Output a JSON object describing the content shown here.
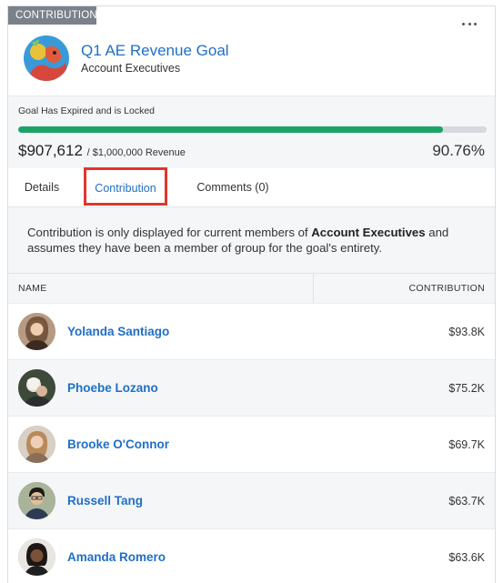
{
  "card": {
    "type_tag": "CONTRIBUTION",
    "more_icon": "ellipsis-icon"
  },
  "goal": {
    "title": "Q1 AE Revenue Goal",
    "group": "Account Executives",
    "status": "Goal Has Expired and is Locked",
    "amount": "$907,612",
    "target": "/ $1,000,000 Revenue",
    "percent": "90.76%",
    "progress_fraction": 0.9076,
    "progress_color": "#1aa367"
  },
  "tabs": [
    {
      "label": "Details",
      "active": false
    },
    {
      "label": "Contribution",
      "active": true
    },
    {
      "label": "Comments (0)",
      "active": false
    }
  ],
  "notice": {
    "prefix": "Contribution is only displayed for current members of ",
    "group": "Account Executives",
    "suffix": " and assumes they have been a member of group for the goal's entirety."
  },
  "table": {
    "headers": {
      "name": "NAME",
      "contribution": "CONTRIBUTION"
    },
    "rows": [
      {
        "name": "Yolanda Santiago",
        "value": "$93.8K"
      },
      {
        "name": "Phoebe Lozano",
        "value": "$75.2K"
      },
      {
        "name": "Brooke O'Connor",
        "value": "$69.7K"
      },
      {
        "name": "Russell Tang",
        "value": "$63.7K"
      },
      {
        "name": "Amanda Romero",
        "value": "$63.6K"
      }
    ]
  },
  "colors": {
    "accent": "#1f6fc5",
    "highlight_border": "#e2352a"
  }
}
